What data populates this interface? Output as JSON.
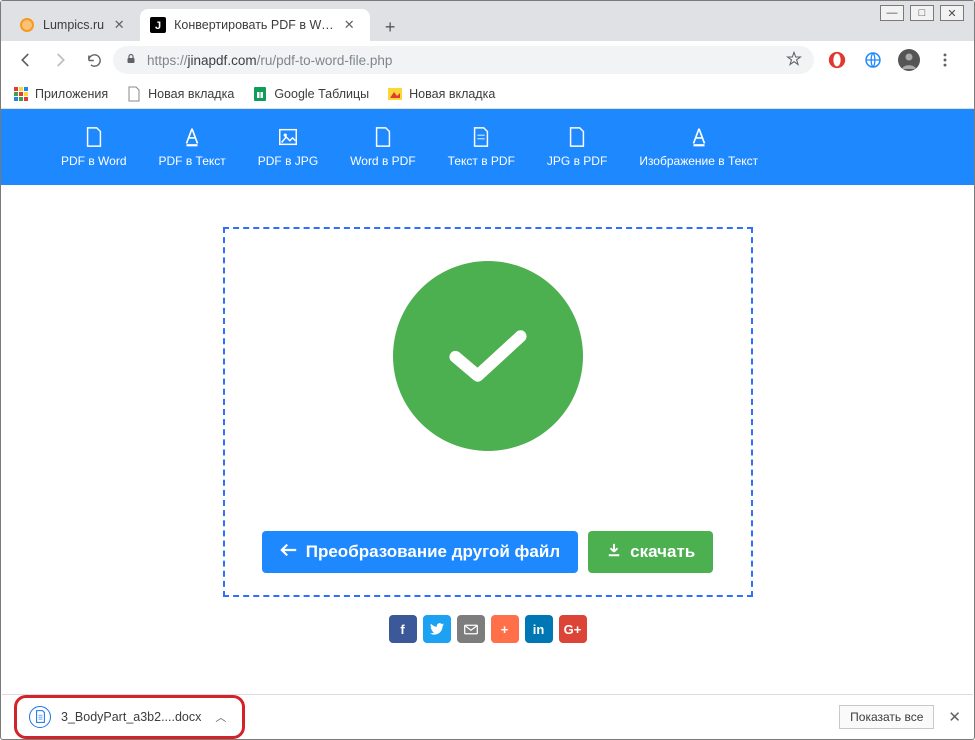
{
  "tabs": [
    {
      "title": "Lumpics.ru",
      "favcolor": "#f79a1c"
    },
    {
      "title": "Конвертировать PDF в Word - P",
      "favcolor": "#000000"
    }
  ],
  "url": {
    "scheme": "https://",
    "host": "jinapdf.com",
    "path": "/ru/pdf-to-word-file.php"
  },
  "bookmarks": [
    {
      "label": "Приложения",
      "ico_type": "apps"
    },
    {
      "label": "Новая вкладка",
      "ico_type": "file"
    },
    {
      "label": "Google Таблицы",
      "ico_type": "sheets"
    },
    {
      "label": "Новая вкладка",
      "ico_type": "img"
    }
  ],
  "toolbar": [
    {
      "label": "PDF в Word"
    },
    {
      "label": "PDF в Текст"
    },
    {
      "label": "PDF в JPG"
    },
    {
      "label": "Word в PDF"
    },
    {
      "label": "Текст в PDF"
    },
    {
      "label": "JPG в PDF"
    },
    {
      "label": "Изображение в Текст"
    }
  ],
  "buttons": {
    "convert": "Преобразование другой файл",
    "download": "скачать"
  },
  "download": {
    "filename": "3_BodyPart_a3b2....docx",
    "show_all": "Показать все"
  },
  "colors": {
    "brand_blue": "#1e88ff",
    "success_green": "#4caf50",
    "dash_blue": "#2e6fff"
  }
}
